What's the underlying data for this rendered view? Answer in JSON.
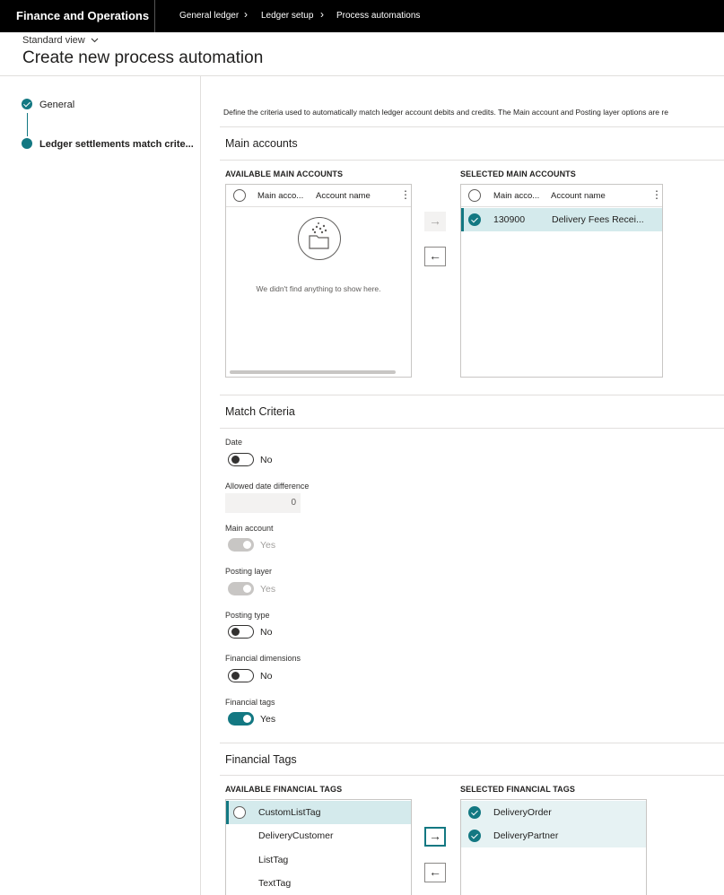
{
  "topbar": {
    "app_name": "Finance and Operations",
    "breadcrumb": [
      "General ledger",
      "Ledger setup",
      "Process automations"
    ]
  },
  "header": {
    "view_label": "Standard view",
    "title": "Create new process automation"
  },
  "steps": [
    {
      "label": "General",
      "state": "completed"
    },
    {
      "label": "Ledger settlements match crite...",
      "state": "current"
    }
  ],
  "description": "Define the criteria used to automatically match ledger account debits and credits. The Main account and Posting layer options are re",
  "main_accounts": {
    "title": "Main accounts",
    "available": {
      "title": "AVAILABLE MAIN ACCOUNTS",
      "columns": [
        "Main acco...",
        "Account name"
      ],
      "empty_text": "We didn't find anything to show here."
    },
    "selected": {
      "title": "SELECTED MAIN ACCOUNTS",
      "columns": [
        "Main acco...",
        "Account name"
      ],
      "rows": [
        {
          "account": "130900",
          "name": "Delivery Fees Recei..."
        }
      ]
    }
  },
  "match_criteria": {
    "title": "Match Criteria",
    "date": {
      "label": "Date",
      "value": "No",
      "on": false
    },
    "allowed_date_difference": {
      "label": "Allowed date difference",
      "value": "0"
    },
    "main_account": {
      "label": "Main account",
      "value": "Yes",
      "on": true,
      "disabled": true
    },
    "posting_layer": {
      "label": "Posting layer",
      "value": "Yes",
      "on": true,
      "disabled": true
    },
    "posting_type": {
      "label": "Posting type",
      "value": "No",
      "on": false
    },
    "financial_dimensions": {
      "label": "Financial dimensions",
      "value": "No",
      "on": false
    },
    "financial_tags": {
      "label": "Financial tags",
      "value": "Yes",
      "on": true
    }
  },
  "financial_tags": {
    "title": "Financial Tags",
    "available": {
      "title": "AVAILABLE FINANCIAL TAGS",
      "items": [
        "CustomListTag",
        "DeliveryCustomer",
        "ListTag",
        "TextTag"
      ]
    },
    "selected": {
      "title": "SELECTED FINANCIAL TAGS",
      "items": [
        "DeliveryOrder",
        "DeliveryPartner"
      ]
    }
  },
  "colors": {
    "accent": "#137882",
    "selected_row": "#d4eaec",
    "topbar": "#000000"
  }
}
